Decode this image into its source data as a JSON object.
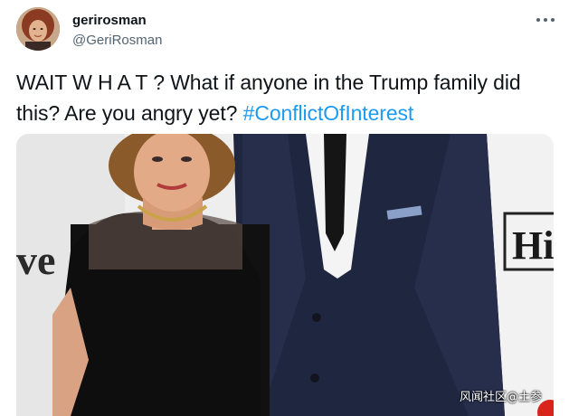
{
  "tweet": {
    "display_name": "gerirosman",
    "handle": "@GeriRosman",
    "text_main": "WAIT W H A T ? What if anyone in the Trump family did this? Are you angry yet?",
    "hashtag": "#ConflictOfInterest",
    "more_icon": "more-horizontal-icon"
  },
  "photo": {
    "backdrop_text_left": "ve",
    "backdrop_text_right": "Hi"
  },
  "watermark": "风闻社区@土参",
  "colors": {
    "hashtag": "#1d9bf0",
    "handle": "#536471",
    "text": "#0f1419"
  }
}
